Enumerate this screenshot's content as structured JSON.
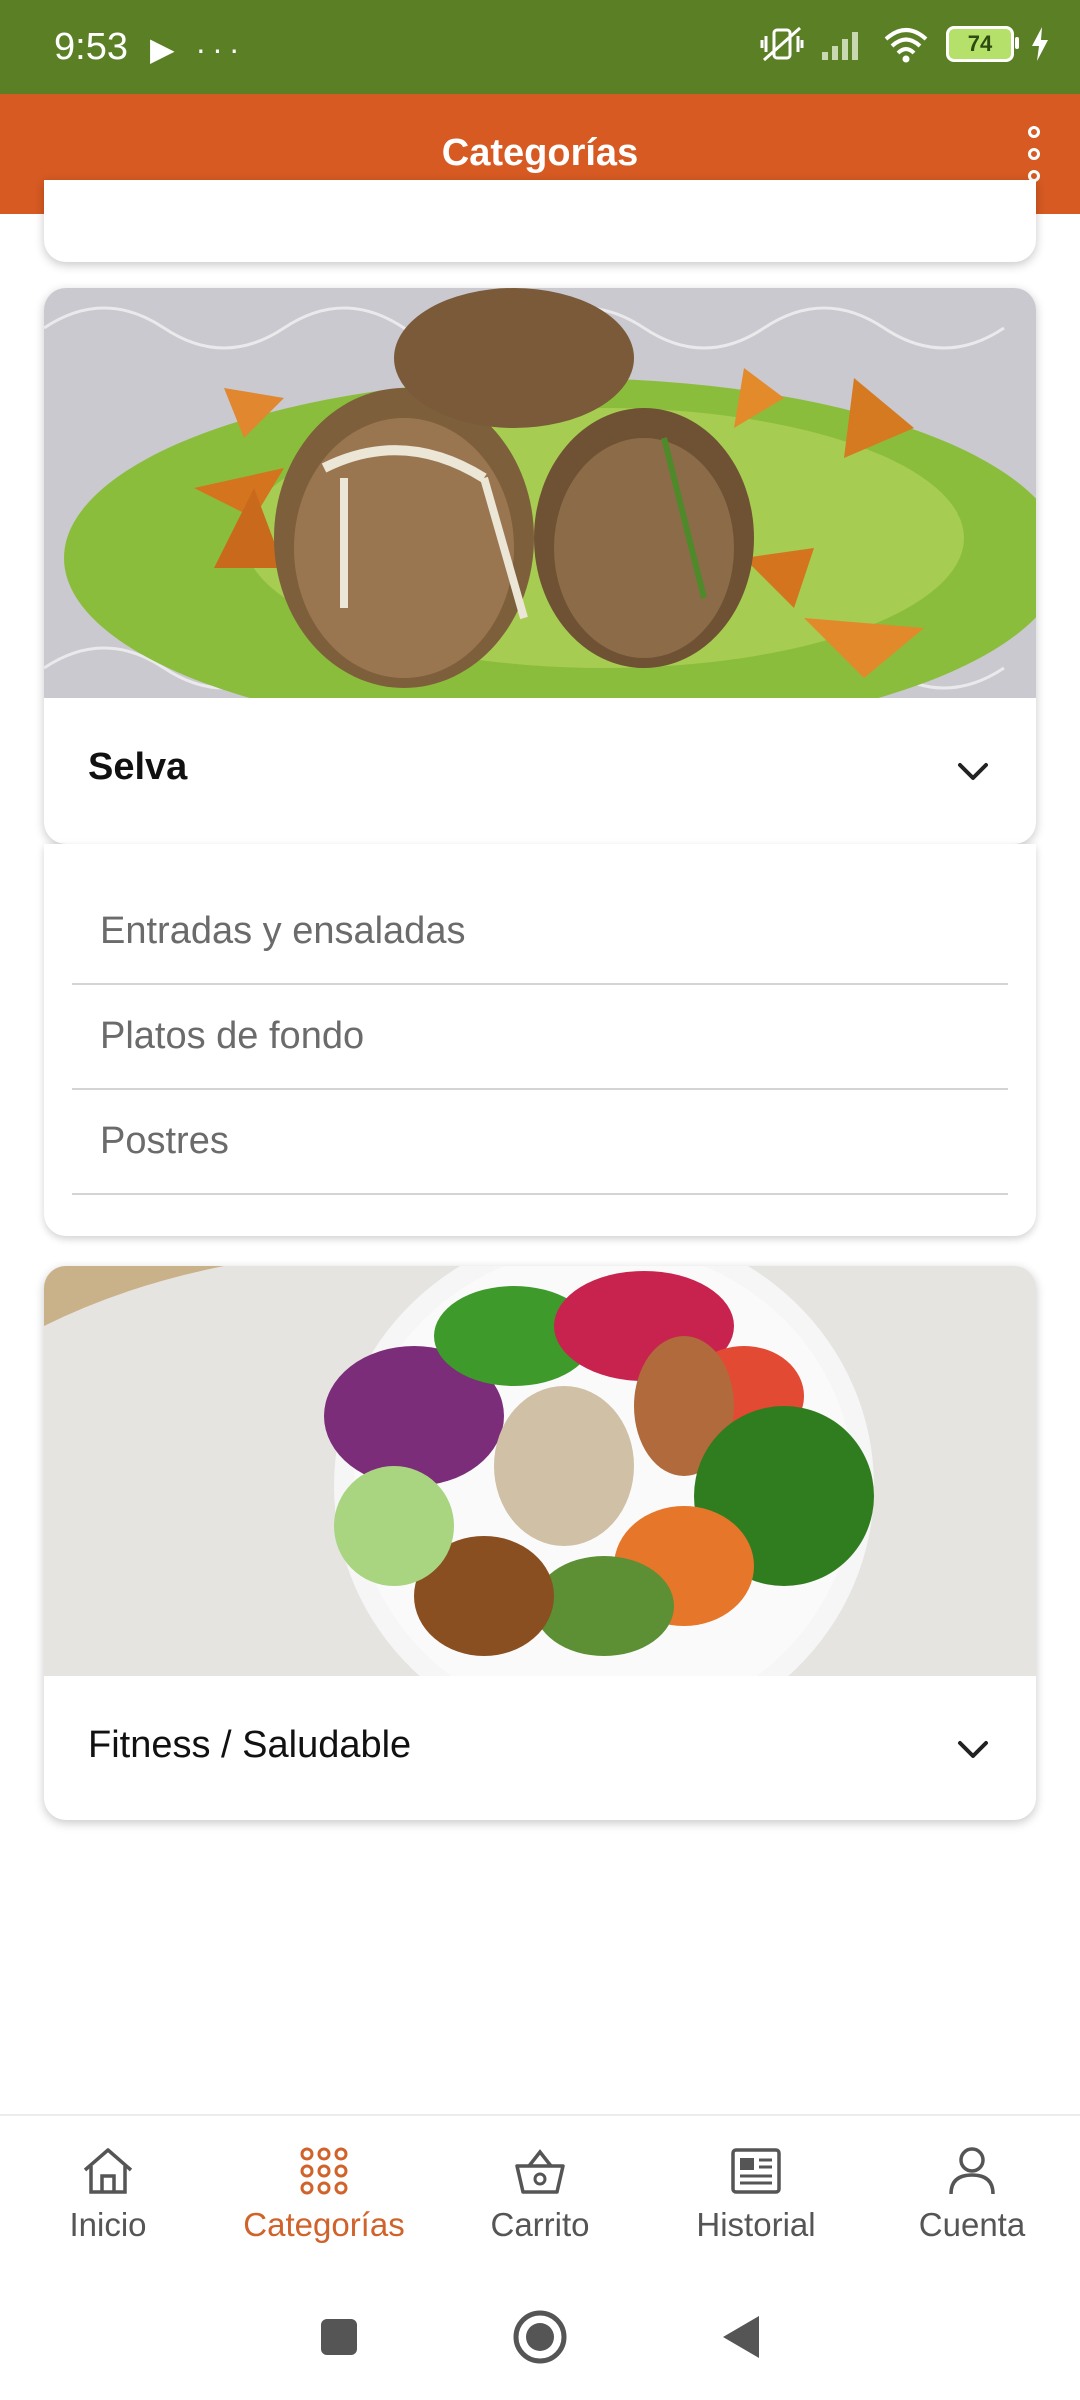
{
  "status_bar": {
    "time": "9:53",
    "left_icons": "▶ ···",
    "battery": "74"
  },
  "app_bar": {
    "title": "Categorías",
    "menu_icon": "more-vert-icon"
  },
  "cards": [
    {
      "title": "Selva",
      "expanded": true,
      "subcategories": [
        "Entradas y ensaladas",
        "Platos de fondo",
        "Postres"
      ]
    },
    {
      "title": "Fitness / Saludable",
      "expanded": false
    }
  ],
  "bottom_nav": [
    {
      "label": "Inicio",
      "icon": "home-icon"
    },
    {
      "label": "Categorías",
      "icon": "grid-dots-icon",
      "active": true
    },
    {
      "label": "Carrito",
      "icon": "basket-icon"
    },
    {
      "label": "Historial",
      "icon": "newspaper-icon"
    },
    {
      "label": "Cuenta",
      "icon": "person-icon"
    }
  ],
  "colors": {
    "status_bar": "#5a7f24",
    "app_bar": "#d75a22",
    "accent": "#d0622a"
  }
}
